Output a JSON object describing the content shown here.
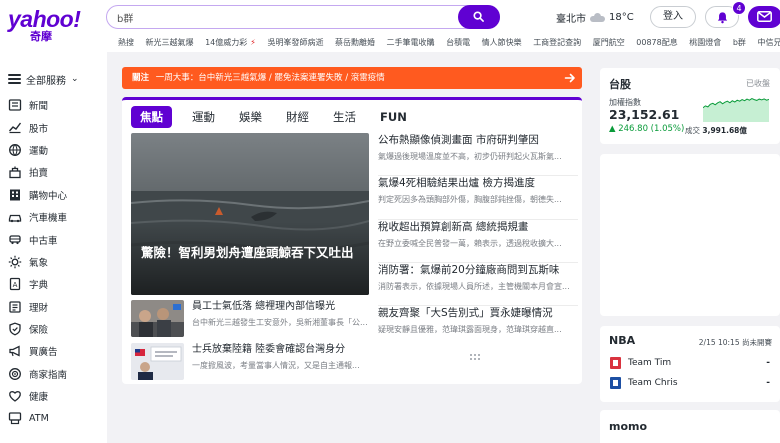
{
  "brand": {
    "name": "yahoo!",
    "sub": "奇摩"
  },
  "search": {
    "value": "b群"
  },
  "weather": {
    "city": "臺北市",
    "temp": "18°C"
  },
  "header": {
    "login_label": "登入",
    "notification_count": "4"
  },
  "trending": [
    "熱搜",
    "新光三越氣爆",
    "14億威力彩",
    "吳明峯發師病逝",
    "蔡岳勳離婚",
    "二手筆電收購",
    "台積電",
    "情人節快樂",
    "工商登記查詢",
    "厦門航空",
    "00878配息",
    "桃園燈會",
    "b群",
    "中信兄弟"
  ],
  "nav": {
    "all_label": "全部服務",
    "items": [
      "新聞",
      "股市",
      "運動",
      "拍賣",
      "購物中心",
      "汽車機車",
      "中古車",
      "氣象",
      "字典",
      "理財",
      "保險",
      "買廣告",
      "商家指南",
      "健康",
      "ATM"
    ]
  },
  "alert": {
    "tag": "關注",
    "text": "一周大事：台中新光三越氣爆 / 罷免法案連署失敗 / 滾雷疫情"
  },
  "tabs": [
    "焦點",
    "運動",
    "娛樂",
    "財經",
    "生活",
    "FUN"
  ],
  "hero": {
    "title": "驚險！智利男划舟遭座頭鯨吞下又吐出"
  },
  "side_stories": [
    {
      "headline": "公布熱顯像偵測畫面 市府研判肇因",
      "summary": "氣爆過後現場溫度並不高，初步仍研判起火瓦斯氣..."
    },
    {
      "headline": "氣爆4死相驗結果出爐 檢方揭進度",
      "summary": "判定死因多為頭胸部外傷，胸腹部鈍挫傷，朝德失..."
    },
    {
      "headline": "稅收超出預算創新高 總統揭規畫",
      "summary": "在野立委喊全民普發一萬，賴表示，透過稅收擴大..."
    },
    {
      "headline": "消防署：氣爆前20分鐘廠商問到瓦斯味",
      "summary": "消防署表示，依據現場人員所述，主管機關本月會宣..."
    },
    {
      "headline": "親友齊聚「大S告別式」賈永婕曝情況",
      "summary": "疑現安靜且優雅，范瑋琪露面現身，范瑋琪穿越直..."
    }
  ],
  "thumb_stories": [
    {
      "headline": "員工士氣低落 總裡理內部信曝光",
      "summary": "台中新光三越發生工安意外，吳新湘董事長「公..."
    },
    {
      "headline": "士兵放棄陸籍 陸委會確認台灣身分",
      "summary": "一度掀風波，考量當事人情況，又是自主通報..."
    }
  ],
  "stock": {
    "title": "台股",
    "status": "已收盤",
    "index_name": "加權指數",
    "value": "23,152.61",
    "change": "▲ 246.80 (1.05%)",
    "volume_label": "成交",
    "volume": "3,991.68億",
    "trend": [
      0.55,
      0.62,
      0.58,
      0.68,
      0.72,
      0.66,
      0.74,
      0.78,
      0.7,
      0.76,
      0.8,
      0.74,
      0.82,
      0.77,
      0.84,
      0.8,
      0.86,
      0.82,
      0.88,
      0.84,
      0.9,
      0.86,
      0.83,
      0.88,
      0.85,
      0.89,
      0.84,
      0.87
    ],
    "colors": {
      "up": "#0a9b3a",
      "fill": "#c6efd3"
    }
  },
  "nba": {
    "title": "NBA",
    "time": "2/15 10:15 尚未開賽",
    "teams": [
      {
        "name": "Team Tim",
        "score": "-"
      },
      {
        "name": "Team Chris",
        "score": "-"
      }
    ]
  },
  "momo": {
    "title": "momo"
  },
  "colors": {
    "brand": "#6001d2",
    "alert": "#ff5a1f"
  }
}
